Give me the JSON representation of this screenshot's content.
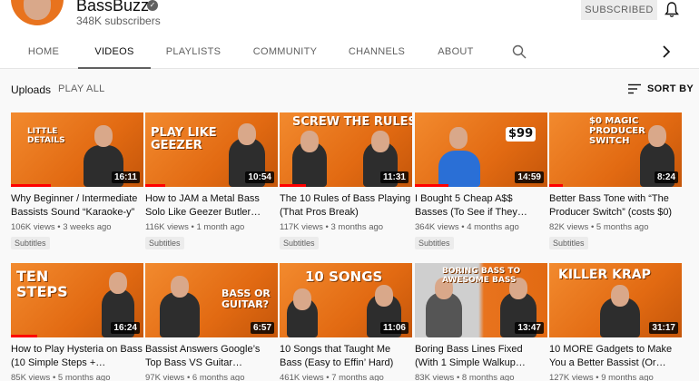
{
  "channel": {
    "name": "BassBuzz",
    "subscribers": "348K subscribers",
    "subscribe_label": "SUBSCRIBED"
  },
  "tabs": [
    {
      "label": "HOME"
    },
    {
      "label": "VIDEOS"
    },
    {
      "label": "PLAYLISTS"
    },
    {
      "label": "COMMUNITY"
    },
    {
      "label": "CHANNELS"
    },
    {
      "label": "ABOUT"
    }
  ],
  "active_tab": "VIDEOS",
  "uploads": {
    "label": "Uploads",
    "play_all": "PLAY ALL",
    "sort_label": "SORT BY"
  },
  "icons": {
    "verified": "verified-icon",
    "bell": "bell-icon",
    "search": "search-icon",
    "chevron": "chevron-right-icon",
    "sort": "sort-icon"
  },
  "colors": {
    "thumbnail_accent": "#e8731e",
    "progress_red": "#ff0000",
    "text_secondary": "#606060"
  },
  "videos": [
    {
      "thumb_text": "LITTLE DETAILS",
      "duration": "16:11",
      "title": "Why Beginner / Intermediate Bassists Sound “Karaoke-y”",
      "views": "106K views",
      "age": "3 weeks ago",
      "badge": "Subtitles",
      "watched": 0.3
    },
    {
      "thumb_text": "PLAY LIKE GEEZER",
      "duration": "10:54",
      "title": "How to JAM a Metal Bass Solo Like Geezer Butler…",
      "views": "116K views",
      "age": "1 month ago",
      "badge": "Subtitles",
      "watched": 0.15
    },
    {
      "thumb_text": "SCREW THE RULES",
      "duration": "11:31",
      "title": "The 10 Rules of Bass Playing (That Pros Break)",
      "views": "117K views",
      "age": "3 months ago",
      "badge": "Subtitles",
      "watched": 0.2
    },
    {
      "thumb_text": "$99",
      "duration": "14:59",
      "title": "I Bought 5 Cheap A$$ Basses (To See if They…",
      "views": "364K views",
      "age": "4 months ago",
      "badge": "Subtitles",
      "watched": 0.25
    },
    {
      "thumb_text": "$0 MAGIC PRODUCER SWITCH",
      "duration": "8:24",
      "title": "Better Bass Tone with “The Producer Switch” (costs $0)",
      "views": "82K views",
      "age": "5 months ago",
      "badge": "Subtitles",
      "watched": 0.1
    },
    {
      "thumb_text": "TEN STEPS",
      "duration": "16:24",
      "title": "How to Play Hysteria on Bass (10 Simple Steps +…",
      "views": "85K views",
      "age": "5 months ago",
      "badge": "",
      "watched": 0.2
    },
    {
      "thumb_text": "BASS OR GUITAR?",
      "duration": "6:57",
      "title": "Bassist Answers Google’s Top Bass VS Guitar…",
      "views": "97K views",
      "age": "6 months ago",
      "badge": "",
      "watched": 0.0
    },
    {
      "thumb_text": "10 SONGS",
      "duration": "11:06",
      "title": "10 Songs that Taught Me Bass (Easy to Effin’ Hard)",
      "views": "461K views",
      "age": "7 months ago",
      "badge": "",
      "watched": 0.0
    },
    {
      "thumb_text": "BORING BASS TO AWESOME BASS",
      "duration": "13:47",
      "title": "Boring Bass Lines Fixed (With 1 Simple Walkup…",
      "views": "83K views",
      "age": "8 months ago",
      "badge": "",
      "watched": 0.0
    },
    {
      "thumb_text": "KILLER KRAP",
      "duration": "31:17",
      "title": "10 MORE Gadgets to Make You a Better Bassist (Or…",
      "views": "127K views",
      "age": "9 months ago",
      "badge": "",
      "watched": 0.0
    }
  ]
}
